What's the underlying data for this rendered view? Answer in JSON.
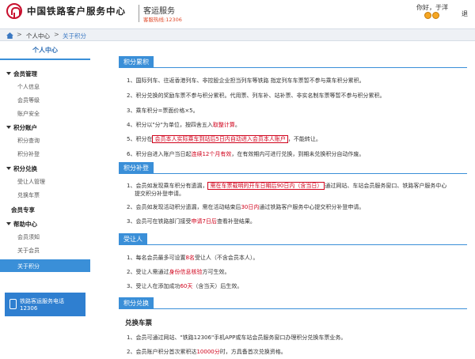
{
  "header": {
    "site_title": "中国铁路客户服务中心",
    "service_name": "客运服务",
    "hotline": "客服热线:12306",
    "greeting": "你好，于洋",
    "logout": "退"
  },
  "breadcrumb": {
    "items": [
      "个人中心",
      "关于积分"
    ],
    "separator": ">"
  },
  "sidebar": {
    "title": "个人中心",
    "groups": [
      {
        "label": "会员管理",
        "items": [
          "个人信息",
          "会员等级",
          "账户安全"
        ]
      },
      {
        "label": "积分账户",
        "items": [
          "积分查询",
          "积分补登"
        ]
      },
      {
        "label": "积分兑换",
        "items": [
          "受让人管理",
          "兑换车票"
        ]
      },
      {
        "label": "会员专享",
        "items": []
      },
      {
        "label": "帮助中心",
        "items": [
          "会员须知",
          "关于会员",
          "关于积分"
        ]
      }
    ],
    "active_item": "关于积分",
    "hotline_label": "铁路客运服务电话",
    "hotline_number": "12306"
  },
  "main": {
    "sections": [
      {
        "tag": "积分累积",
        "rows": [
          "1、国际列车、往返香港列车、非控股企业担当列车等铁路 指定列车车票暂不参与乘车积分累积。",
          "2、积分兑换的奖励车票不参与积分累积。代用票、列车补、站补票、非实名制车票等暂不参与积分累积。",
          "3、乘车积分=票面价格×5。",
          "4、积分以\"分\"为单位，按四舍五入取整计算。",
          "5、积分在会员本人实际乘车到站后5日内自动进入会员本人账户。不能转让。",
          "6、积分自进入账户当日起连续12个月有效，在有效期内可进行兑换，到期未兑换积分自动作废。"
        ]
      },
      {
        "tag": "积分补登",
        "rows": [
          "1、会员如发现乘车积分有遗漏，需在车票载明的开车日期后90日内（含当日）通过网站、车站会员服务窗口、铁路客户服务中心提交积分补登申请。",
          "2、会员如发现活动积分遗漏，需在活动结束后30日内通过铁路客户服务中心提交积分补登申请。",
          "3、会员可在铁路部门接受申请7日后查看补登结果。"
        ]
      },
      {
        "tag": "受让人",
        "rows": [
          "1、每名会员最多可设置8名受让人（不含会员本人）。",
          "2、受让人需通过身份信息核验方可生效。",
          "3、受让人在添加成功60天（含当天）后生效。"
        ]
      },
      {
        "tag": "积分兑换",
        "subhead": "兑换车票",
        "rows": [
          "1、会员可通过网站、\"铁路12306\"手机APP或车站会员服务窗口办理积分兑换车票业务。",
          "2、会员账户积分首次累积达10000分时，方具备首次兑换资格。"
        ]
      }
    ],
    "accum_row4_pre": "4、积分以\"分\"为单位，按四舍五入",
    "accum_row4_red": "取整计算",
    "accum_row4_post": "。",
    "accum_row5_pre": "5、积分在",
    "accum_row5_box": "会员本人实际乘车到站后5日内自动进入会员本人账户",
    "accum_row5_post": "，不能转让。",
    "accum_row6_pre": "6、积分自进入账户当日起",
    "accum_row6_red": "连续12个月有效",
    "accum_row6_post": "，在有效期内可进行兑换，到期未兑换积分自动作废。",
    "supp_row1_pre": "1、会员如发现乘车积分有遗漏，",
    "supp_row1_box": "需在车票载明的开车日期后90日内（含当日）",
    "supp_row1_post": "通过网站、车站会员服务窗口、铁路客户服务中心",
    "supp_row1_cont": "提交积分补登申请。",
    "supp_row2_pre": "2、会员如发现活动积分遗漏，需在活动结束后",
    "supp_row2_red": "30日内",
    "supp_row2_post": "通过铁路客户服务中心提交积分补登申请。",
    "supp_row3_pre": "3、会员可在铁路部门接受",
    "supp_row3_red": "申请7日后",
    "supp_row3_post": "查看补登结果。",
    "tr_row1_pre": "1、每名会员最多可设置",
    "tr_row1_red": "8名",
    "tr_row1_post": "受让人（不含会员本人）。",
    "tr_row2_pre": "2、受让人需通过",
    "tr_row2_red": "身份信息核验",
    "tr_row2_post": "方可生效。",
    "tr_row3_pre": "3、受让人在添加成功",
    "tr_row3_red": "60天",
    "tr_row3_post": "（含当天）后生效。",
    "ex_row2_pre": "2、会员账户积分首次累积达",
    "ex_row2_red": "10000分",
    "ex_row2_post": "时，方具备首次兑换资格。"
  },
  "colors": {
    "accent": "#3a8fd8",
    "emphasis": "#d0021b",
    "hotline": "#e04a2a"
  }
}
